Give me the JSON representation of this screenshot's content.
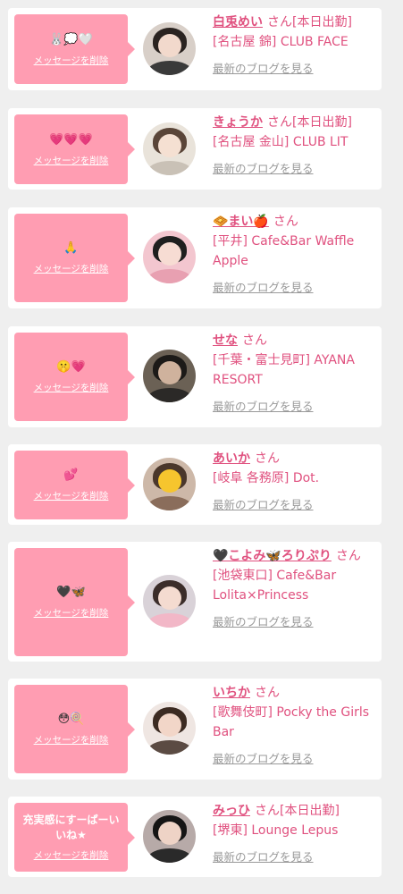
{
  "delete_label": "メッセージを削除",
  "blog_label": "最新のブログを見る",
  "honorific": "さん",
  "accent_color": "#e0517f",
  "bubble_color": "#ff9db2",
  "cards": [
    {
      "message": "🐰💭🤍",
      "message_type": "emoji",
      "name": "白兎めい",
      "status": "[本日出勤]",
      "shop": "[名古屋 錦] CLUB FACE",
      "avatar_icon": "girl-selfie-avatar"
    },
    {
      "message": "💗💗💗",
      "message_type": "emoji",
      "name": "きょうか",
      "status": "[本日出勤]",
      "shop": "[名古屋 金山] CLUB LIT",
      "avatar_icon": "girl-portrait-avatar"
    },
    {
      "message": "🙏",
      "message_type": "emoji",
      "name": "🧇まい🍎",
      "status": "",
      "shop": "[平井] Cafe&Bar Waffle Apple",
      "avatar_icon": "heart-covered-face-avatar"
    },
    {
      "message": "🤫💗",
      "message_type": "emoji",
      "name": "せな",
      "status": "",
      "shop": "[千葉・富士見町] AYANA RESORT",
      "avatar_icon": "dark-room-avatar"
    },
    {
      "message": "💕",
      "message_type": "emoji",
      "name": "あいか",
      "status": "",
      "shop": "[岐阜 各務原] Dot.",
      "avatar_icon": "heart-eyes-face-avatar"
    },
    {
      "message": "🖤🦋",
      "message_type": "emoji",
      "name": "🖤こよみ🦋ろりぷり",
      "status": "",
      "shop": "[池袋東口] Cafe&Bar Lolita×Princess",
      "avatar_icon": "lolita-girl-avatar"
    },
    {
      "message": "😳🍭",
      "message_type": "emoji",
      "name": "いちか",
      "status": "",
      "shop": "[歌舞伎町] Pocky the Girls Bar",
      "avatar_icon": "girl-with-sticker-avatar"
    },
    {
      "message": "充実感にすーぱーいいね★",
      "message_type": "text",
      "name": "みっひ",
      "status": "[本日出勤]",
      "shop": "[堺東] Lounge Lepus",
      "avatar_icon": "girl-closeup-avatar"
    }
  ]
}
